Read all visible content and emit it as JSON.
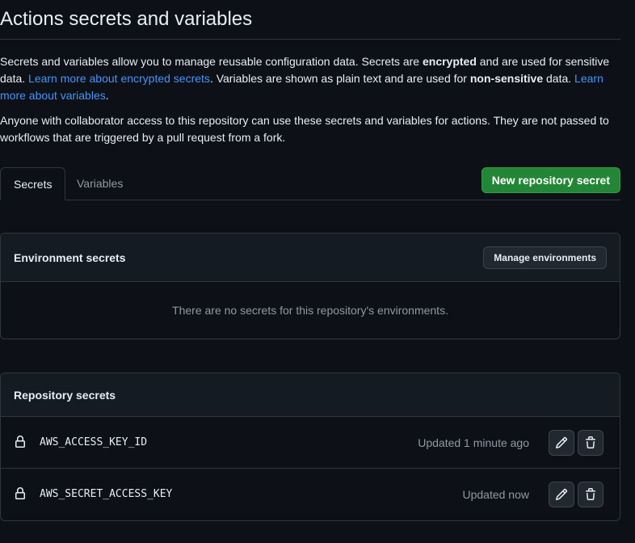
{
  "header": {
    "title": "Actions secrets and variables"
  },
  "intro": {
    "p1_a": "Secrets and variables allow you to manage reusable configuration data. Secrets are ",
    "p1_b": "encrypted",
    "p1_c": " and are used for sensitive data. ",
    "p1_link1": "Learn more about encrypted secrets",
    "p1_d": ". Variables are shown as plain text and are used for ",
    "p1_e": "non-sensitive",
    "p1_f": " data. ",
    "p1_link2": "Learn more about variables",
    "p1_g": ".",
    "p2": "Anyone with collaborator access to this repository can use these secrets and variables for actions. They are not passed to workflows that are triggered by a pull request from a fork."
  },
  "tabs": {
    "secrets": "Secrets",
    "variables": "Variables"
  },
  "new_secret_button": "New repository secret",
  "environment_secrets": {
    "title": "Environment secrets",
    "manage_button": "Manage environments",
    "empty_text": "There are no secrets for this repository's environments."
  },
  "repository_secrets": {
    "title": "Repository secrets",
    "items": [
      {
        "name": "AWS_ACCESS_KEY_ID",
        "updated": "Updated 1 minute ago"
      },
      {
        "name": "AWS_SECRET_ACCESS_KEY",
        "updated": "Updated now"
      }
    ]
  },
  "icons": {
    "lock": "lock-icon",
    "edit": "pencil-icon",
    "delete": "trash-icon"
  },
  "colors": {
    "background": "#0d1117",
    "link": "#4493f8",
    "primary_button": "#238636",
    "muted_text": "#9198a1",
    "border": "#30363d"
  }
}
